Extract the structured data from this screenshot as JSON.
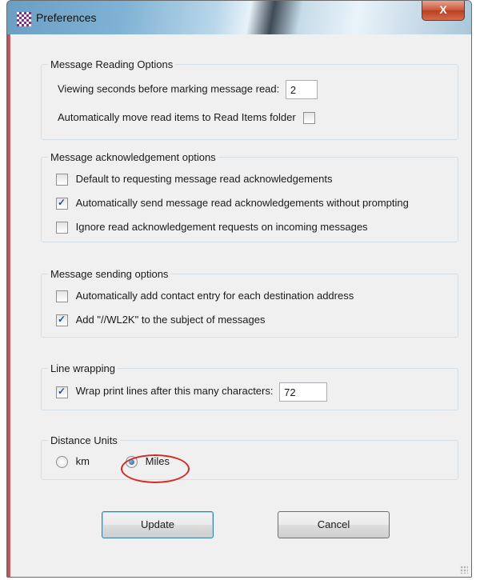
{
  "window": {
    "title": "Preferences",
    "close_glyph": "X"
  },
  "reading": {
    "legend": "Message Reading Options",
    "viewing_seconds_label": "Viewing seconds before marking message read:",
    "viewing_seconds_value": "2",
    "auto_move_label": "Automatically move read items to Read Items folder",
    "auto_move_checked": false
  },
  "acknowledgement": {
    "legend": "Message acknowledgement options",
    "items": [
      {
        "label": "Default to requesting message read acknowledgements",
        "checked": false
      },
      {
        "label": "Automatically send message read acknowledgements without prompting",
        "checked": true
      },
      {
        "label": "Ignore read acknowledgement requests on incoming messages",
        "checked": false
      }
    ]
  },
  "sending": {
    "legend": "Message sending options",
    "items": [
      {
        "label": "Automatically add contact entry for each destination address",
        "checked": false
      },
      {
        "label": "Add \"//WL2K\" to the subject of messages",
        "checked": true
      }
    ]
  },
  "wrapping": {
    "legend": "Line wrapping",
    "label": "Wrap print lines after this many characters:",
    "checked": true,
    "value": "72"
  },
  "distance": {
    "legend": "Distance Units",
    "options": [
      {
        "label": "km",
        "selected": false
      },
      {
        "label": "Miles",
        "selected": true
      }
    ],
    "annotation_color": "#d62828"
  },
  "buttons": {
    "update": "Update",
    "cancel": "Cancel"
  }
}
